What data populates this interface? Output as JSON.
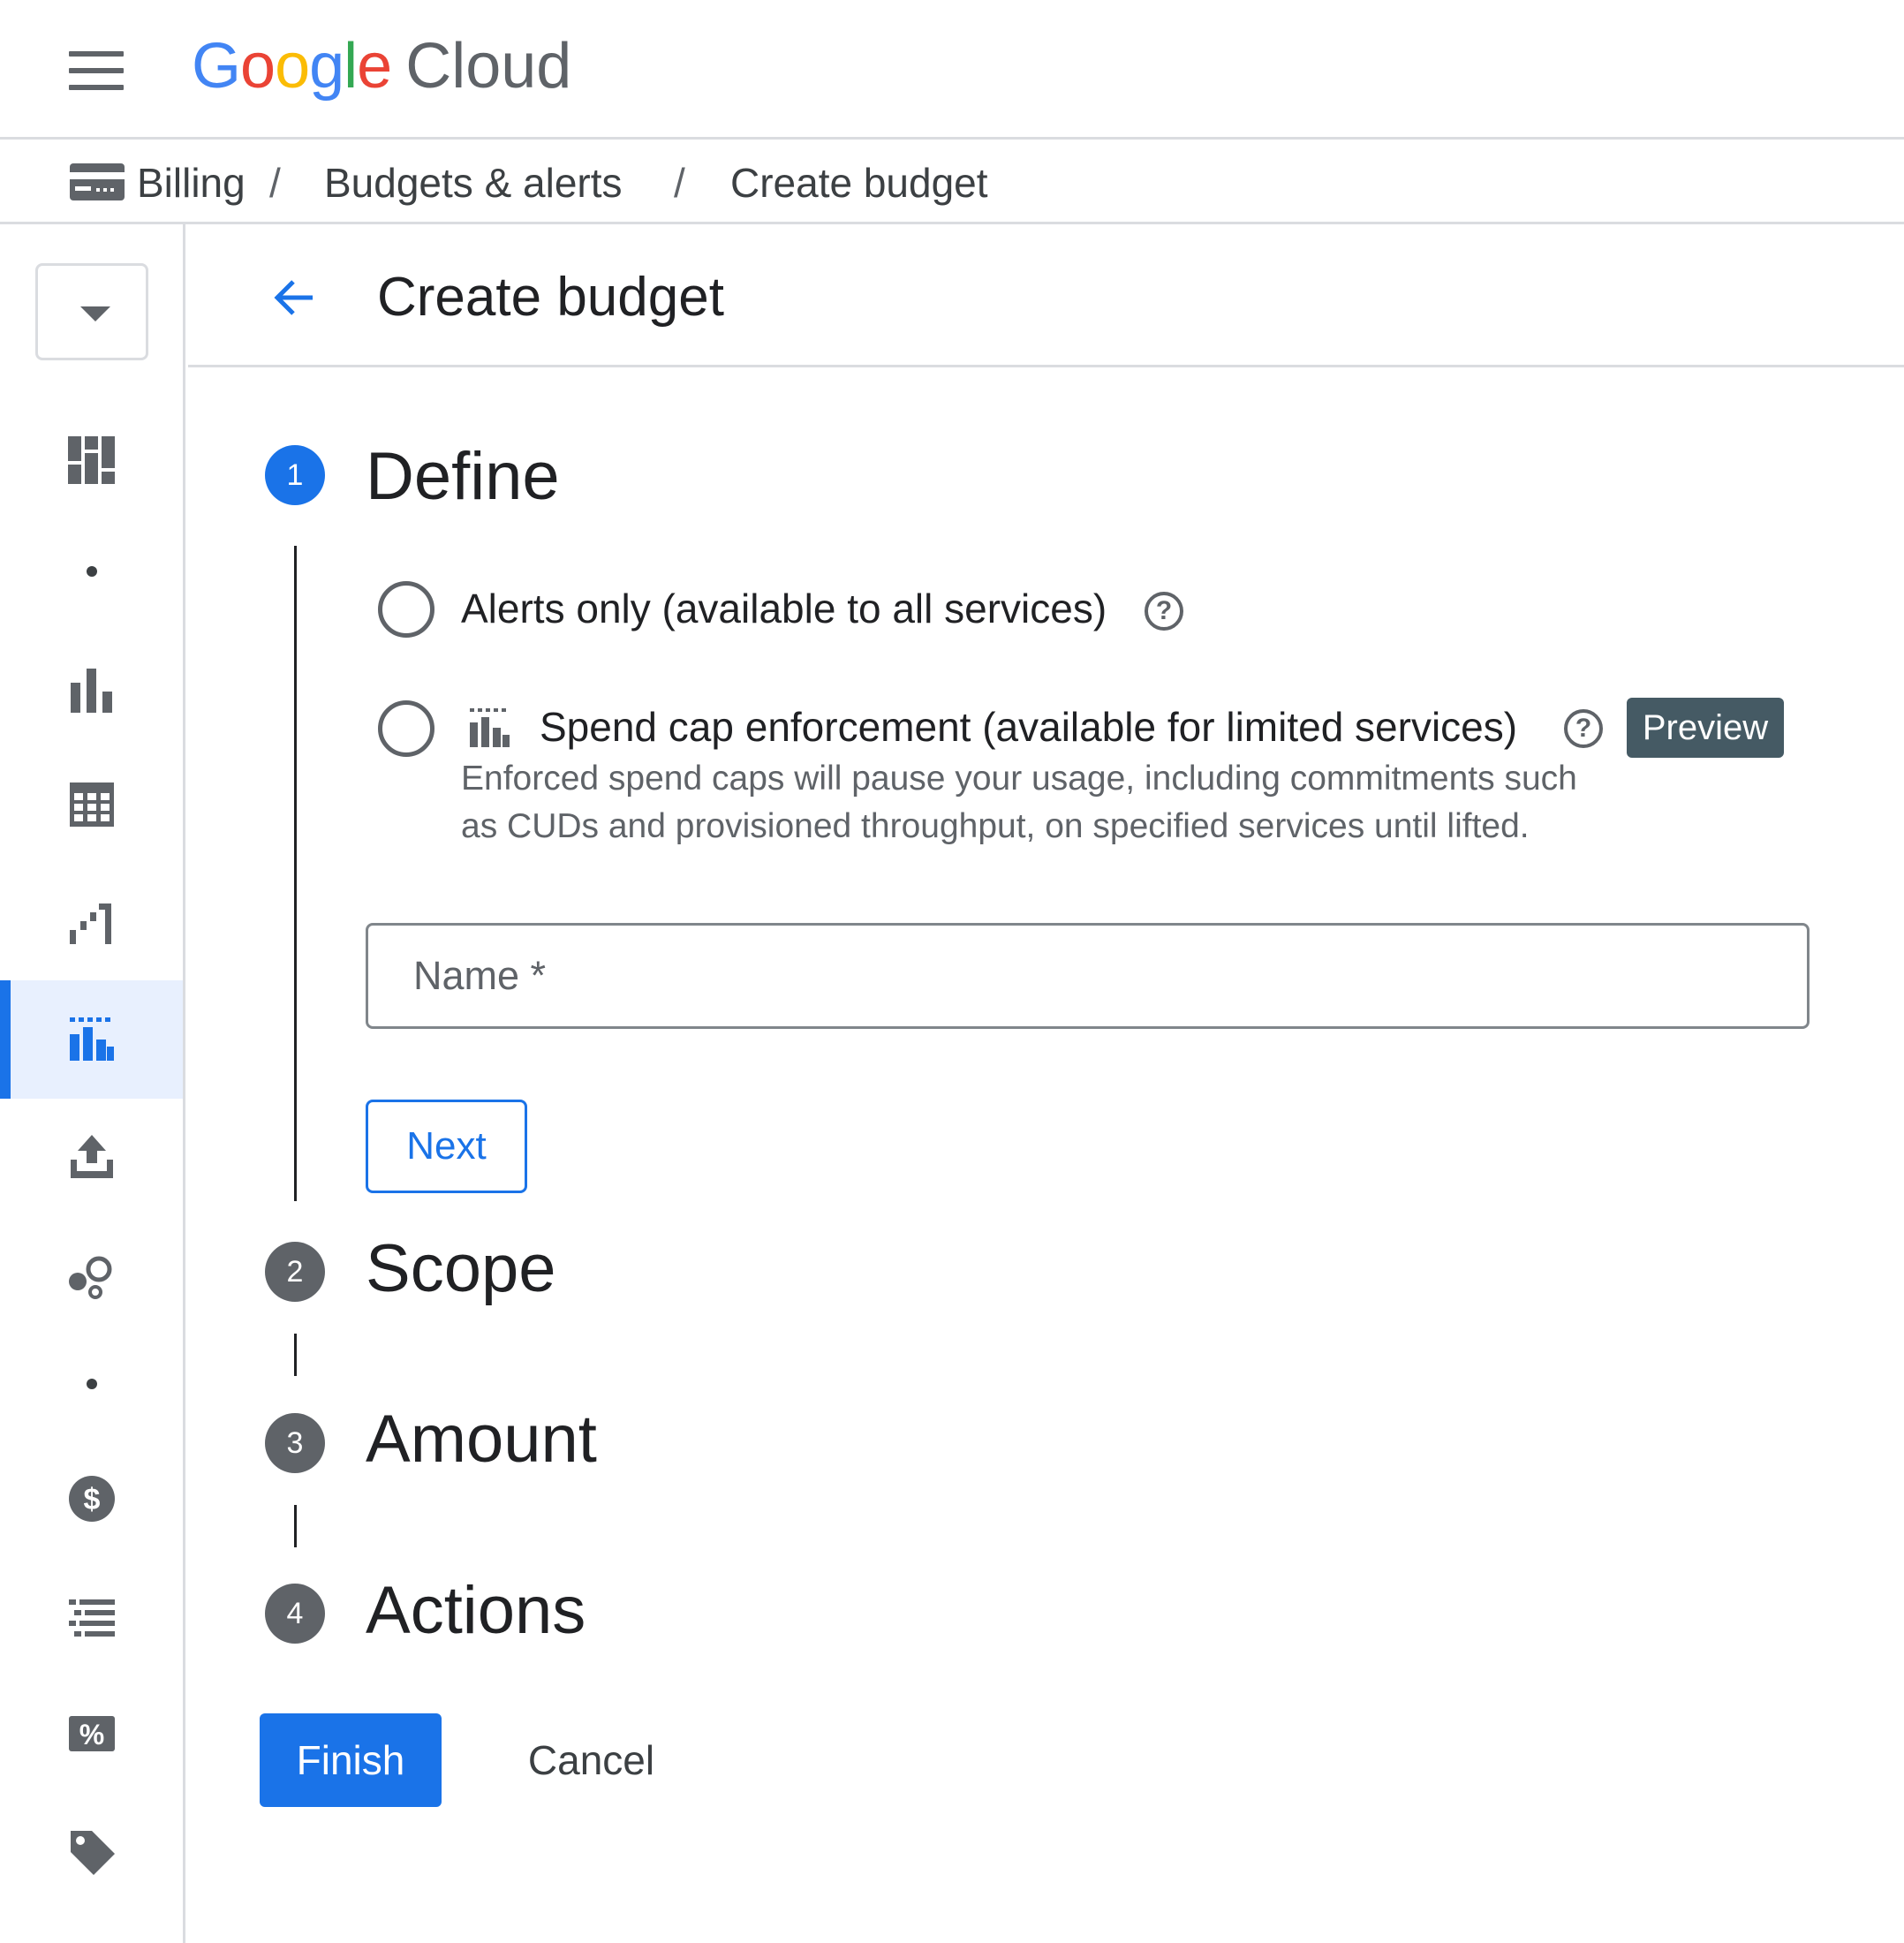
{
  "header": {
    "logo_letters": [
      {
        "char": "G",
        "color": "#4285F4"
      },
      {
        "char": "o",
        "color": "#EA4335"
      },
      {
        "char": "o",
        "color": "#FBBC05"
      },
      {
        "char": "g",
        "color": "#4285F4"
      },
      {
        "char": "l",
        "color": "#34A853"
      },
      {
        "char": "e",
        "color": "#EA4335"
      }
    ],
    "logo_suffix": "Cloud"
  },
  "breadcrumb": {
    "icon": "billing-card-icon",
    "items": [
      "Billing",
      "Budgets & alerts",
      "Create budget"
    ],
    "separator": "/"
  },
  "sidebar": {
    "icons": [
      "overview-dashboard-icon",
      "dot",
      "bar-chart-icon",
      "table-icon",
      "trend-chart-icon",
      "budgets-icon",
      "export-upload-icon",
      "circles-icon",
      "dot",
      "dollar-icon",
      "list-icon",
      "percent-icon",
      "tag-icon"
    ],
    "active_index": 5
  },
  "page": {
    "title": "Create budget"
  },
  "steps": [
    {
      "number": "1",
      "title": "Define",
      "active": true
    },
    {
      "number": "2",
      "title": "Scope",
      "active": false
    },
    {
      "number": "3",
      "title": "Amount",
      "active": false
    },
    {
      "number": "4",
      "title": "Actions",
      "active": false
    }
  ],
  "define": {
    "options": [
      {
        "label": "Alerts only (available to all services)",
        "selected": false
      },
      {
        "label": "Spend cap enforcement (available for limited services)",
        "selected": false,
        "badge": "Preview",
        "description_lines": [
          "Enforced spend caps will pause your usage, including commitments such",
          "as CUDs and provisioned throughput, on specified services until lifted."
        ]
      }
    ],
    "help_glyph": "?",
    "name_placeholder": "Name *",
    "name_value": "",
    "next_label": "Next"
  },
  "footer": {
    "finish_label": "Finish",
    "cancel_label": "Cancel"
  },
  "colors": {
    "primary": "#1a73e8",
    "active_bg": "#e8f0fe",
    "badge_bg": "#455a64",
    "step_inactive": "#5f6368"
  }
}
